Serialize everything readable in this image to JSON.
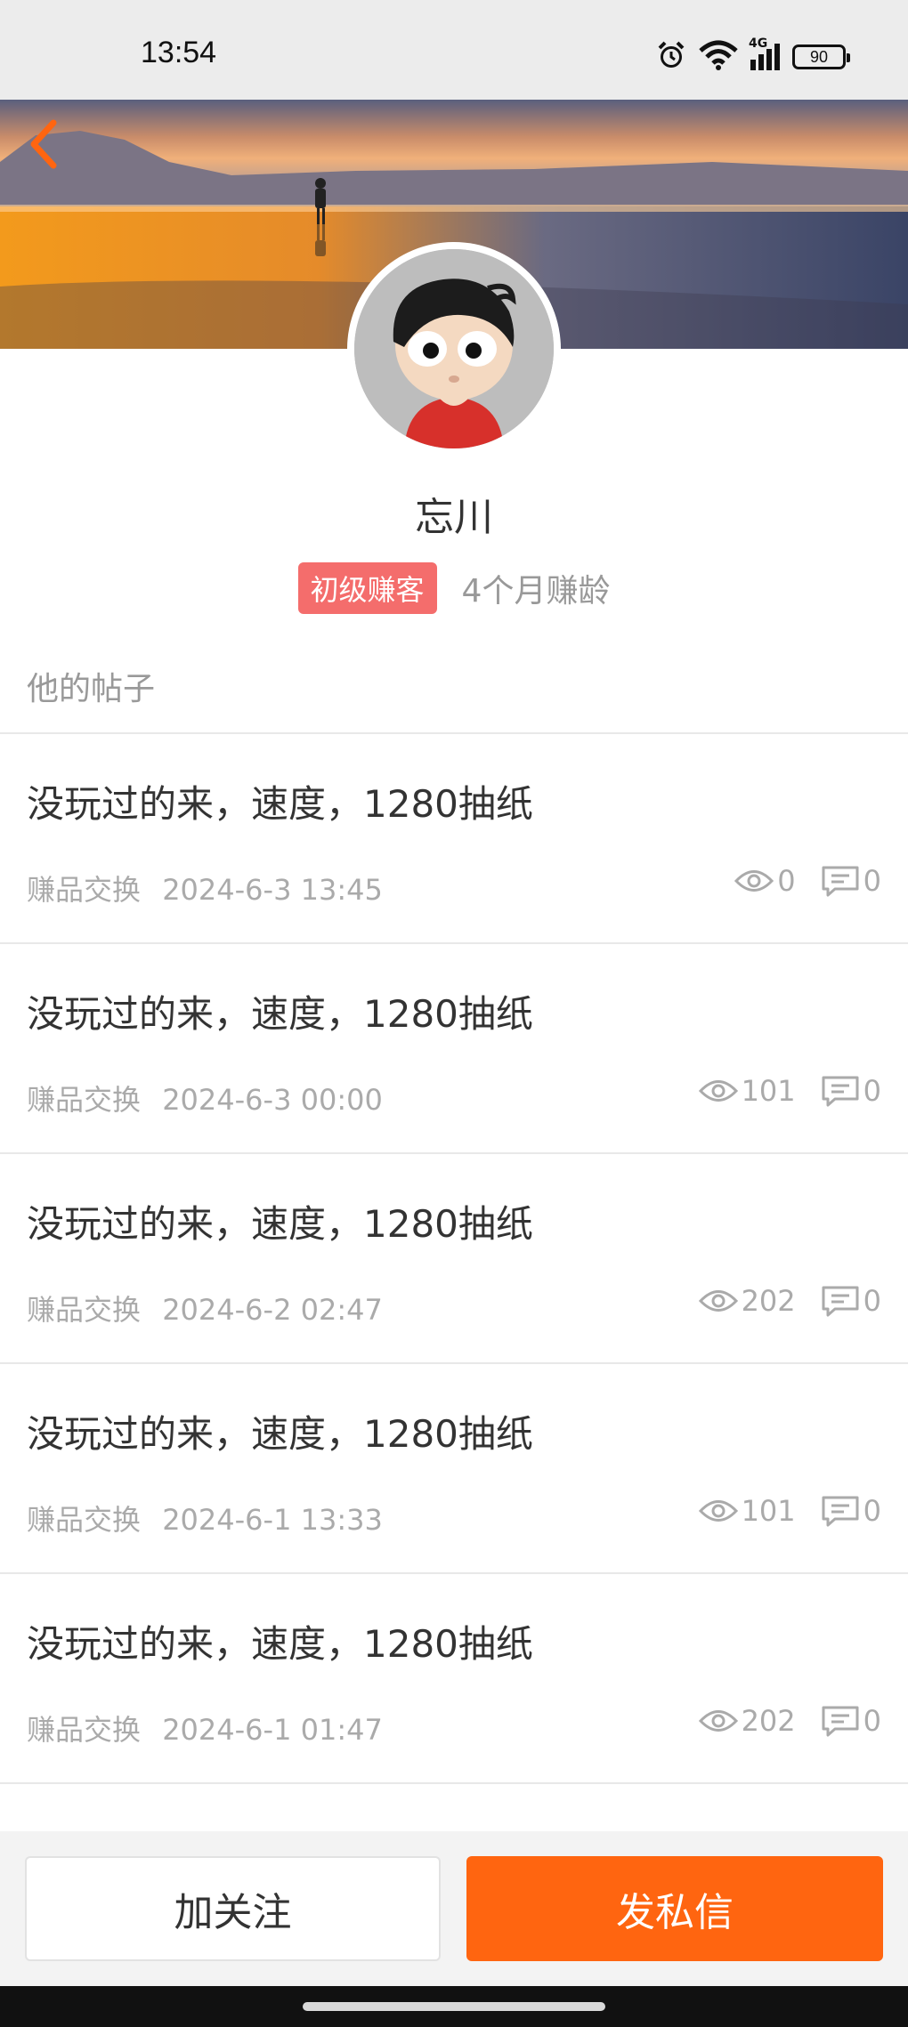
{
  "status_bar": {
    "time": "13:54",
    "network": "4G",
    "battery": "90",
    "icons": [
      "alarm-icon",
      "wifi-icon",
      "signal-icon",
      "battery-icon"
    ]
  },
  "header": {
    "back_icon": "chevron-left-icon",
    "accent_color": "#ff6510"
  },
  "profile": {
    "name": "忘川",
    "level": "初级赚客",
    "age": "4个月赚龄"
  },
  "section_title": "他的帖子",
  "posts": [
    {
      "title": "没玩过的来，速度，1280抽纸",
      "category": "赚品交换",
      "time": "2024-6-3 13:45",
      "views": "0",
      "comments": "0"
    },
    {
      "title": "没玩过的来，速度，1280抽纸",
      "category": "赚品交换",
      "time": "2024-6-3 00:00",
      "views": "101",
      "comments": "0"
    },
    {
      "title": "没玩过的来，速度，1280抽纸",
      "category": "赚品交换",
      "time": "2024-6-2 02:47",
      "views": "202",
      "comments": "0"
    },
    {
      "title": "没玩过的来，速度，1280抽纸",
      "category": "赚品交换",
      "time": "2024-6-1 13:33",
      "views": "101",
      "comments": "0"
    },
    {
      "title": "没玩过的来，速度，1280抽纸",
      "category": "赚品交换",
      "time": "2024-6-1 01:47",
      "views": "202",
      "comments": "0"
    }
  ],
  "actions": {
    "follow": "加关注",
    "message": "发私信"
  }
}
